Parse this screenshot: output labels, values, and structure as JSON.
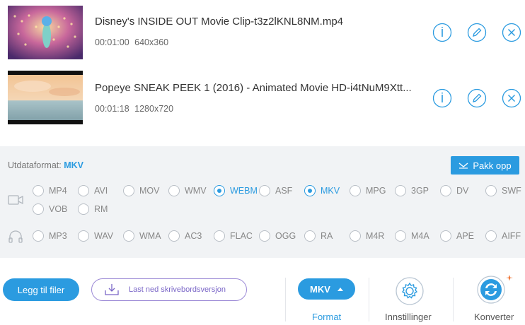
{
  "files": [
    {
      "name": "Disney's INSIDE OUT Movie Clip-t3z2lKNL8NM.mp4",
      "duration": "00:01:00",
      "resolution": "640x360"
    },
    {
      "name": "Popeye SNEAK PEEK 1 (2016) - Animated Movie HD-i4tNuM9Xtt...",
      "duration": "00:01:18",
      "resolution": "1280x720"
    }
  ],
  "file_actions": {
    "info_icon": "info-icon",
    "edit_icon": "pencil-icon",
    "remove_icon": "close-icon"
  },
  "output": {
    "label": "Utdataformat:",
    "value": "MKV",
    "unpack_label": "Pakk opp"
  },
  "video_formats": {
    "icon": "video-icon",
    "options": [
      "MP4",
      "AVI",
      "MOV",
      "WMV",
      "WEBM",
      "ASF",
      "MKV",
      "MPG",
      "3GP",
      "DV",
      "SWF",
      "VOB",
      "RM"
    ],
    "selected": [
      "WEBM",
      "MKV"
    ]
  },
  "audio_formats": {
    "icon": "headphones-icon",
    "options": [
      "MP3",
      "WAV",
      "WMA",
      "AC3",
      "FLAC",
      "OGG",
      "RA",
      "M4R",
      "M4A",
      "APE",
      "AIFF"
    ],
    "selected": []
  },
  "bottom": {
    "add_files": "Legg til filer",
    "download_desktop": "Last ned skrivebordsversjon",
    "format_value": "MKV",
    "format_label": "Format",
    "settings_label": "Innstillinger",
    "convert_label": "Konverter"
  },
  "colors": {
    "accent": "#2b9be0",
    "panel": "#f1f3f5",
    "purple": "#7a66c7"
  }
}
